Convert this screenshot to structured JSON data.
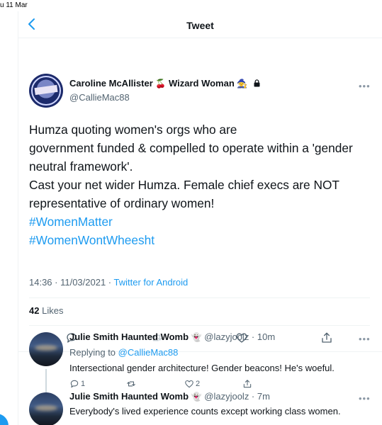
{
  "status_bar": {
    "date": "u 11 Mar"
  },
  "header": {
    "title": "Tweet"
  },
  "tweet": {
    "author_name": "Caroline McAllister",
    "author_suffix": "Wizard Woman",
    "handle": "@CallieMac88",
    "lines": [
      "Humza quoting women's orgs who are",
      "government funded & compelled to operate within a 'gender neutral framework'.",
      "Cast your net wider Humza. Female chief execs are NOT representative of ordinary women!"
    ],
    "hashtags": [
      "#WomenMatter",
      "#WomenWontWheesht"
    ],
    "timestamp": "14:36 · 11/03/2021 · ",
    "source": "Twitter for Android",
    "likes_count": "42",
    "likes_label": "Likes"
  },
  "replies": [
    {
      "name": "Julie Smith Haunted Womb",
      "handle_time": "@lazyjoolz · 10m",
      "replying_prefix": "Replying to ",
      "replying_to": "@CallieMac88",
      "text": "Intersectional gender architecture! Gender beacons! He's woeful.",
      "reply_count": "1",
      "like_count": "2"
    },
    {
      "name": "Julie Smith Haunted Womb",
      "handle_time": "@lazyjoolz · 7m",
      "text": "Everybody's lived experience counts except working class women."
    }
  ]
}
